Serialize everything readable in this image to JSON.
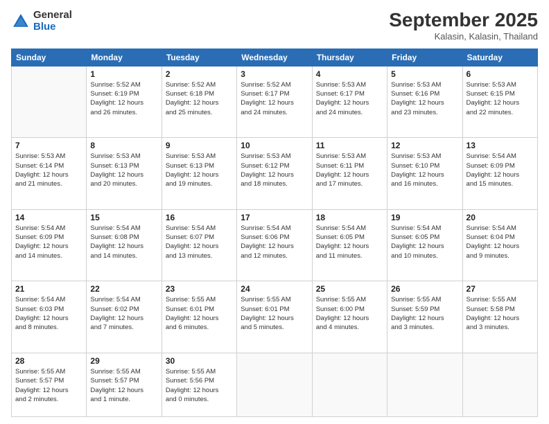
{
  "header": {
    "logo": {
      "general": "General",
      "blue": "Blue"
    },
    "title": "September 2025",
    "subtitle": "Kalasin, Kalasin, Thailand"
  },
  "weekdays": [
    "Sunday",
    "Monday",
    "Tuesday",
    "Wednesday",
    "Thursday",
    "Friday",
    "Saturday"
  ],
  "weeks": [
    [
      {
        "day": "",
        "info": ""
      },
      {
        "day": "1",
        "info": "Sunrise: 5:52 AM\nSunset: 6:19 PM\nDaylight: 12 hours\nand 26 minutes."
      },
      {
        "day": "2",
        "info": "Sunrise: 5:52 AM\nSunset: 6:18 PM\nDaylight: 12 hours\nand 25 minutes."
      },
      {
        "day": "3",
        "info": "Sunrise: 5:52 AM\nSunset: 6:17 PM\nDaylight: 12 hours\nand 24 minutes."
      },
      {
        "day": "4",
        "info": "Sunrise: 5:53 AM\nSunset: 6:17 PM\nDaylight: 12 hours\nand 24 minutes."
      },
      {
        "day": "5",
        "info": "Sunrise: 5:53 AM\nSunset: 6:16 PM\nDaylight: 12 hours\nand 23 minutes."
      },
      {
        "day": "6",
        "info": "Sunrise: 5:53 AM\nSunset: 6:15 PM\nDaylight: 12 hours\nand 22 minutes."
      }
    ],
    [
      {
        "day": "7",
        "info": "Sunrise: 5:53 AM\nSunset: 6:14 PM\nDaylight: 12 hours\nand 21 minutes."
      },
      {
        "day": "8",
        "info": "Sunrise: 5:53 AM\nSunset: 6:13 PM\nDaylight: 12 hours\nand 20 minutes."
      },
      {
        "day": "9",
        "info": "Sunrise: 5:53 AM\nSunset: 6:13 PM\nDaylight: 12 hours\nand 19 minutes."
      },
      {
        "day": "10",
        "info": "Sunrise: 5:53 AM\nSunset: 6:12 PM\nDaylight: 12 hours\nand 18 minutes."
      },
      {
        "day": "11",
        "info": "Sunrise: 5:53 AM\nSunset: 6:11 PM\nDaylight: 12 hours\nand 17 minutes."
      },
      {
        "day": "12",
        "info": "Sunrise: 5:53 AM\nSunset: 6:10 PM\nDaylight: 12 hours\nand 16 minutes."
      },
      {
        "day": "13",
        "info": "Sunrise: 5:54 AM\nSunset: 6:09 PM\nDaylight: 12 hours\nand 15 minutes."
      }
    ],
    [
      {
        "day": "14",
        "info": "Sunrise: 5:54 AM\nSunset: 6:09 PM\nDaylight: 12 hours\nand 14 minutes."
      },
      {
        "day": "15",
        "info": "Sunrise: 5:54 AM\nSunset: 6:08 PM\nDaylight: 12 hours\nand 14 minutes."
      },
      {
        "day": "16",
        "info": "Sunrise: 5:54 AM\nSunset: 6:07 PM\nDaylight: 12 hours\nand 13 minutes."
      },
      {
        "day": "17",
        "info": "Sunrise: 5:54 AM\nSunset: 6:06 PM\nDaylight: 12 hours\nand 12 minutes."
      },
      {
        "day": "18",
        "info": "Sunrise: 5:54 AM\nSunset: 6:05 PM\nDaylight: 12 hours\nand 11 minutes."
      },
      {
        "day": "19",
        "info": "Sunrise: 5:54 AM\nSunset: 6:05 PM\nDaylight: 12 hours\nand 10 minutes."
      },
      {
        "day": "20",
        "info": "Sunrise: 5:54 AM\nSunset: 6:04 PM\nDaylight: 12 hours\nand 9 minutes."
      }
    ],
    [
      {
        "day": "21",
        "info": "Sunrise: 5:54 AM\nSunset: 6:03 PM\nDaylight: 12 hours\nand 8 minutes."
      },
      {
        "day": "22",
        "info": "Sunrise: 5:54 AM\nSunset: 6:02 PM\nDaylight: 12 hours\nand 7 minutes."
      },
      {
        "day": "23",
        "info": "Sunrise: 5:55 AM\nSunset: 6:01 PM\nDaylight: 12 hours\nand 6 minutes."
      },
      {
        "day": "24",
        "info": "Sunrise: 5:55 AM\nSunset: 6:01 PM\nDaylight: 12 hours\nand 5 minutes."
      },
      {
        "day": "25",
        "info": "Sunrise: 5:55 AM\nSunset: 6:00 PM\nDaylight: 12 hours\nand 4 minutes."
      },
      {
        "day": "26",
        "info": "Sunrise: 5:55 AM\nSunset: 5:59 PM\nDaylight: 12 hours\nand 3 minutes."
      },
      {
        "day": "27",
        "info": "Sunrise: 5:55 AM\nSunset: 5:58 PM\nDaylight: 12 hours\nand 3 minutes."
      }
    ],
    [
      {
        "day": "28",
        "info": "Sunrise: 5:55 AM\nSunset: 5:57 PM\nDaylight: 12 hours\nand 2 minutes."
      },
      {
        "day": "29",
        "info": "Sunrise: 5:55 AM\nSunset: 5:57 PM\nDaylight: 12 hours\nand 1 minute."
      },
      {
        "day": "30",
        "info": "Sunrise: 5:55 AM\nSunset: 5:56 PM\nDaylight: 12 hours\nand 0 minutes."
      },
      {
        "day": "",
        "info": ""
      },
      {
        "day": "",
        "info": ""
      },
      {
        "day": "",
        "info": ""
      },
      {
        "day": "",
        "info": ""
      }
    ]
  ]
}
